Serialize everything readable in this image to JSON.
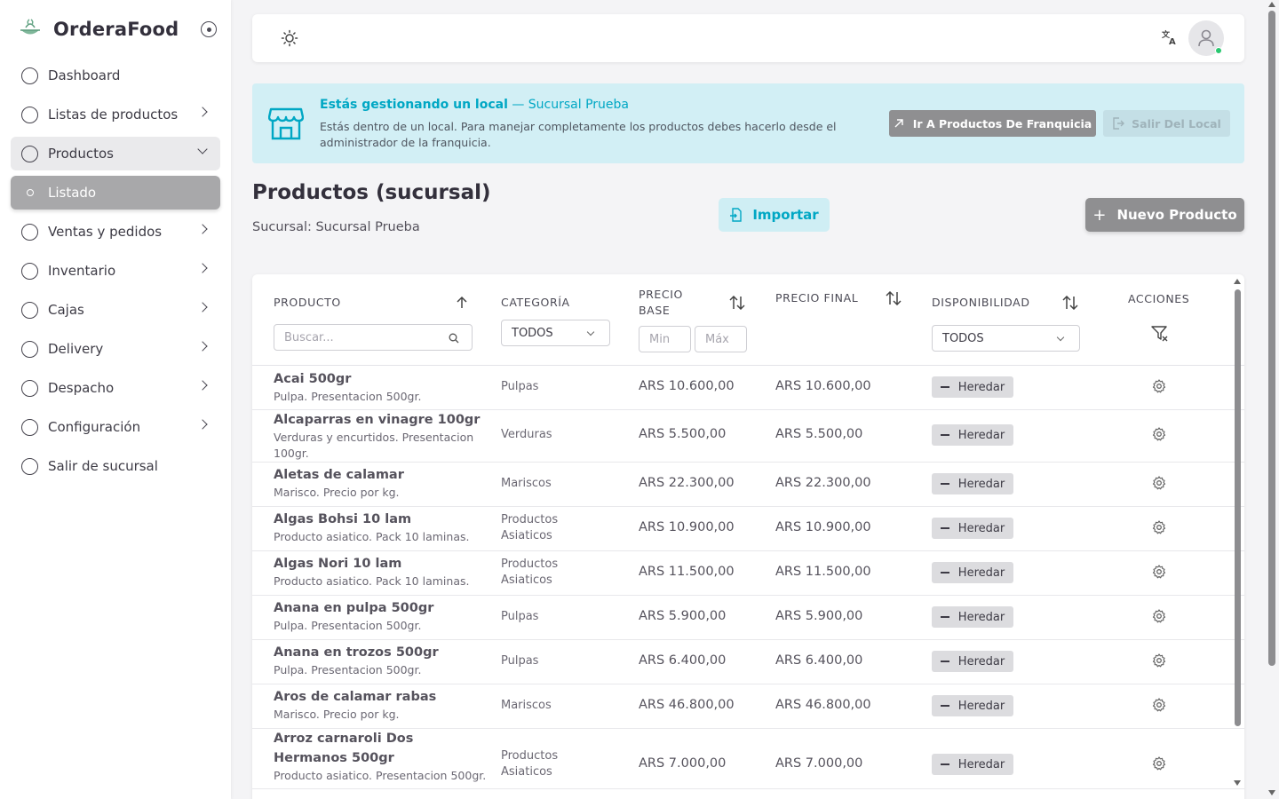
{
  "brand": {
    "name": "OrderaFood"
  },
  "sidebar": {
    "items": [
      {
        "label": "Dashboard",
        "has_chevron": false
      },
      {
        "label": "Listas de productos",
        "has_chevron": true
      },
      {
        "label": "Productos",
        "has_chevron": true,
        "open": true
      },
      {
        "label": "Listado",
        "active": true
      },
      {
        "label": "Ventas y pedidos",
        "has_chevron": true
      },
      {
        "label": "Inventario",
        "has_chevron": true
      },
      {
        "label": "Cajas",
        "has_chevron": true
      },
      {
        "label": "Delivery",
        "has_chevron": true
      },
      {
        "label": "Despacho",
        "has_chevron": true
      },
      {
        "label": "Configuración",
        "has_chevron": true
      },
      {
        "label": "Salir de sucursal",
        "has_chevron": false
      }
    ]
  },
  "topbar": {
    "theme_icon": "sun-icon",
    "translate_icon": "translate-icon",
    "avatar_icon": "user-icon"
  },
  "banner": {
    "title": "Estás gestionando un local",
    "subtitle": "— Sucursal Prueba",
    "text": "Estás dentro de un local. Para manejar completamente los productos debes hacerlo desde el administrador de la franquicia.",
    "btn_franquicia": "Ir A Productos De Franquicia",
    "btn_salir": "Salir Del Local"
  },
  "page": {
    "title": "Productos (sucursal)",
    "subtitle": "Sucursal: Sucursal Prueba",
    "import_label": "Importar",
    "new_label": "Nuevo Producto"
  },
  "table": {
    "headers": {
      "producto": "PRODUCTO",
      "categoria": "CATEGORÍA",
      "precio_base_1": "PRECIO",
      "precio_base_2": "BASE",
      "precio_final": "PRECIO FINAL",
      "disponibilidad": "DISPONIBILIDAD",
      "acciones": "ACCIONES"
    },
    "filters": {
      "search_placeholder": "Buscar...",
      "categoria_value": "TODOS",
      "min_placeholder": "Min",
      "max_placeholder": "Máx",
      "disponibilidad_value": "TODOS"
    },
    "rows": [
      {
        "name": "Acai 500gr",
        "desc": "Pulpa. Presentacion 500gr.",
        "cat": "Pulpas",
        "base": "ARS 10.600,00",
        "final": "ARS 10.600,00",
        "status": "Heredar"
      },
      {
        "name": "Alcaparras en vinagre 100gr",
        "desc": "Verduras y encurtidos. Presentacion 100gr.",
        "cat": "Verduras",
        "base": "ARS 5.500,00",
        "final": "ARS 5.500,00",
        "status": "Heredar"
      },
      {
        "name": "Aletas de calamar",
        "desc": "Marisco. Precio por kg.",
        "cat": "Mariscos",
        "base": "ARS 22.300,00",
        "final": "ARS 22.300,00",
        "status": "Heredar"
      },
      {
        "name": "Algas Bohsi 10 lam",
        "desc": "Producto asiatico. Pack 10 laminas.",
        "cat": "Productos Asiaticos",
        "base": "ARS 10.900,00",
        "final": "ARS 10.900,00",
        "status": "Heredar"
      },
      {
        "name": "Algas Nori 10 lam",
        "desc": "Producto asiatico. Pack 10 laminas.",
        "cat": "Productos Asiaticos",
        "base": "ARS 11.500,00",
        "final": "ARS 11.500,00",
        "status": "Heredar"
      },
      {
        "name": "Anana en pulpa 500gr",
        "desc": "Pulpa. Presentacion 500gr.",
        "cat": "Pulpas",
        "base": "ARS 5.900,00",
        "final": "ARS 5.900,00",
        "status": "Heredar"
      },
      {
        "name": "Anana en trozos 500gr",
        "desc": "Pulpa. Presentacion 500gr.",
        "cat": "Pulpas",
        "base": "ARS 6.400,00",
        "final": "ARS 6.400,00",
        "status": "Heredar"
      },
      {
        "name": "Aros de calamar rabas",
        "desc": "Marisco. Precio por kg.",
        "cat": "Mariscos",
        "base": "ARS 46.800,00",
        "final": "ARS 46.800,00",
        "status": "Heredar"
      },
      {
        "name": "Arroz carnaroli Dos Hermanos 500gr",
        "desc": "Producto asiatico. Presentacion 500gr.",
        "cat": "Productos Asiaticos",
        "base": "ARS 7.000,00",
        "final": "ARS 7.000,00",
        "status": "Heredar"
      }
    ]
  }
}
